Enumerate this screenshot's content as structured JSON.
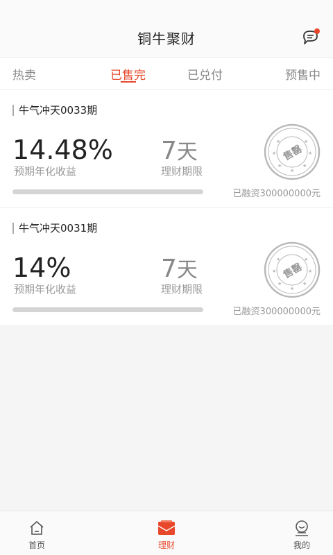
{
  "header": {
    "title": "铜牛聚财"
  },
  "tabs": [
    {
      "label": "热卖",
      "active": false
    },
    {
      "label": "已售完",
      "active": true
    },
    {
      "label": "已兑付",
      "active": false
    },
    {
      "label": "预售中",
      "active": false
    }
  ],
  "products": [
    {
      "title": "牛气冲天0033期",
      "rate": "14.48%",
      "rate_label": "预期年化收益",
      "term_num": "7",
      "term_unit": "天",
      "term_label": "理财期限",
      "stamp_text": "售罄",
      "progress": 1.0,
      "raised": "已融资300000000元"
    },
    {
      "title": "牛气冲天0031期",
      "rate": "14%",
      "rate_label": "预期年化收益",
      "term_num": "7",
      "term_unit": "天",
      "term_label": "理财期限",
      "stamp_text": "售罄",
      "progress": 1.0,
      "raised": "已融资300000000元"
    }
  ],
  "bottom_nav": [
    {
      "label": "首页",
      "icon": "home-icon",
      "active": false
    },
    {
      "label": "理财",
      "icon": "wallet-icon",
      "active": true
    },
    {
      "label": "我的",
      "icon": "user-icon",
      "active": false
    }
  ],
  "colors": {
    "accent": "#e8472b",
    "stamp": "#b8b8b8",
    "background": "#f5f5f5"
  }
}
